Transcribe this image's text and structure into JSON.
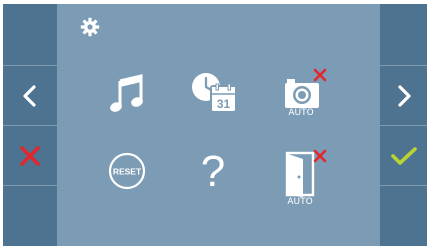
{
  "panel": {
    "camera_label": "AUTO",
    "door_label": "AUTO",
    "reset_label": "RESET",
    "calendar_day": "31",
    "help_glyph": "?"
  },
  "icons": {
    "settings": "gear-icon",
    "music": "music-note-icon",
    "datetime": "clock-calendar-icon",
    "camera": "camera-icon",
    "reset": "reset-icon",
    "help": "question-mark-icon",
    "door": "door-open-icon",
    "disabled_mark": "red-x-icon",
    "prev": "chevron-left-icon",
    "next": "chevron-right-icon",
    "cancel": "cancel-x-icon",
    "confirm": "checkmark-icon"
  },
  "colors": {
    "side_bg": "#4d7391",
    "panel_bg": "#7c9cb5",
    "separator": "#7f9bb2",
    "icon_white": "#ffffff",
    "cancel_red": "#e3262b",
    "confirm_green": "#b8d432"
  }
}
